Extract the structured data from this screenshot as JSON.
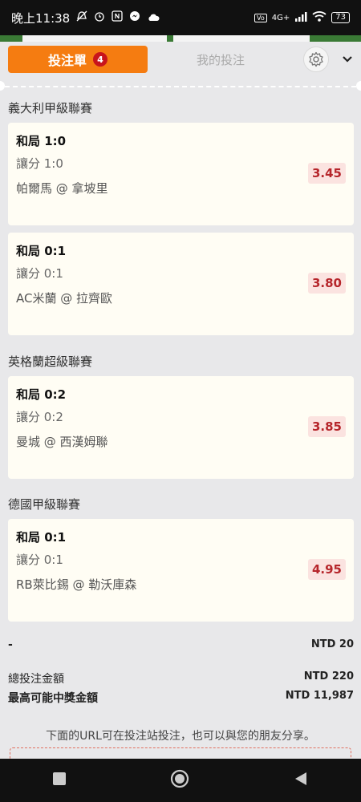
{
  "status": {
    "time": "晚上11:38",
    "battery": "73",
    "network": "4G+"
  },
  "header": {
    "slip_label": "投注單",
    "slip_count": "4",
    "mybets_label": "我的投注"
  },
  "leagues": [
    {
      "name": "義大利甲級聯賽"
    },
    {
      "name": "英格蘭超級聯賽"
    },
    {
      "name": "德國甲級聯賽"
    }
  ],
  "bets": [
    {
      "selection": "和局 1:0",
      "market": "讓分 1:0",
      "match": "帕爾馬 @ 拿坡里",
      "odds": "3.45"
    },
    {
      "selection": "和局 0:1",
      "market": "讓分 0:1",
      "match": "AC米蘭 @ 拉齊歐",
      "odds": "3.80"
    },
    {
      "selection": "和局 0:2",
      "market": "讓分 0:2",
      "match": "曼城 @ 西漢姆聯",
      "odds": "3.85"
    },
    {
      "selection": "和局 0:1",
      "market": "讓分 0:1",
      "match": "RB萊比錫 @ 勒沃庫森",
      "odds": "4.95"
    }
  ],
  "summary": {
    "stake_label": "-",
    "stake_value": "NTD 20",
    "total_label": "總投注金額",
    "total_value": "NTD 220",
    "max_label": "最高可能中獎金額",
    "max_value": "NTD 11,987"
  },
  "share_text": "下面的URL可在投注站投注，也可以與您的朋友分享。",
  "colors": {
    "accent": "#f57c11",
    "odds_text": "#b6262b",
    "badge": "#c8141c"
  }
}
